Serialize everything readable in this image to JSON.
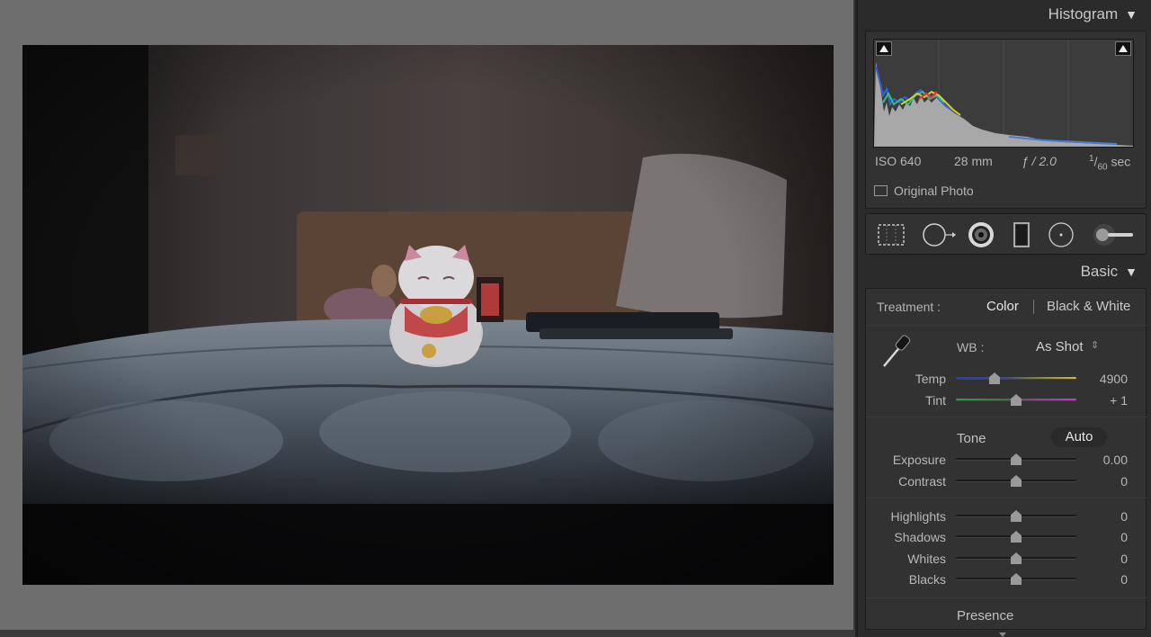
{
  "histogram": {
    "title": "Histogram",
    "exif": {
      "iso": "ISO 640",
      "focal": "28 mm",
      "aperture": "ƒ / 2.0",
      "shutter_num": "1",
      "shutter_den": "60",
      "shutter_unit": "sec"
    },
    "original_photo_label": "Original Photo"
  },
  "tools": [
    "crop-overlay-icon",
    "spot-removal-icon",
    "red-eye-icon",
    "graduated-filter-icon",
    "radial-filter-icon",
    "adjustment-brush-icon"
  ],
  "basic": {
    "title": "Basic",
    "treatment_label": "Treatment :",
    "treatment_color": "Color",
    "treatment_bw": "Black & White",
    "wb_label": "WB :",
    "wb_value": "As Shot",
    "tone_label": "Tone",
    "auto_label": "Auto",
    "sliders": {
      "temp": {
        "label": "Temp",
        "value": "4900",
        "position": 0.32
      },
      "tint": {
        "label": "Tint",
        "value": "+ 1",
        "position": 0.5
      },
      "exposure": {
        "label": "Exposure",
        "value": "0.00",
        "position": 0.5
      },
      "contrast": {
        "label": "Contrast",
        "value": "0",
        "position": 0.5
      },
      "highlights": {
        "label": "Highlights",
        "value": "0",
        "position": 0.5
      },
      "shadows": {
        "label": "Shadows",
        "value": "0",
        "position": 0.5
      },
      "whites": {
        "label": "Whites",
        "value": "0",
        "position": 0.5
      },
      "blacks": {
        "label": "Blacks",
        "value": "0",
        "position": 0.5
      }
    }
  },
  "presence": {
    "title": "Presence"
  }
}
